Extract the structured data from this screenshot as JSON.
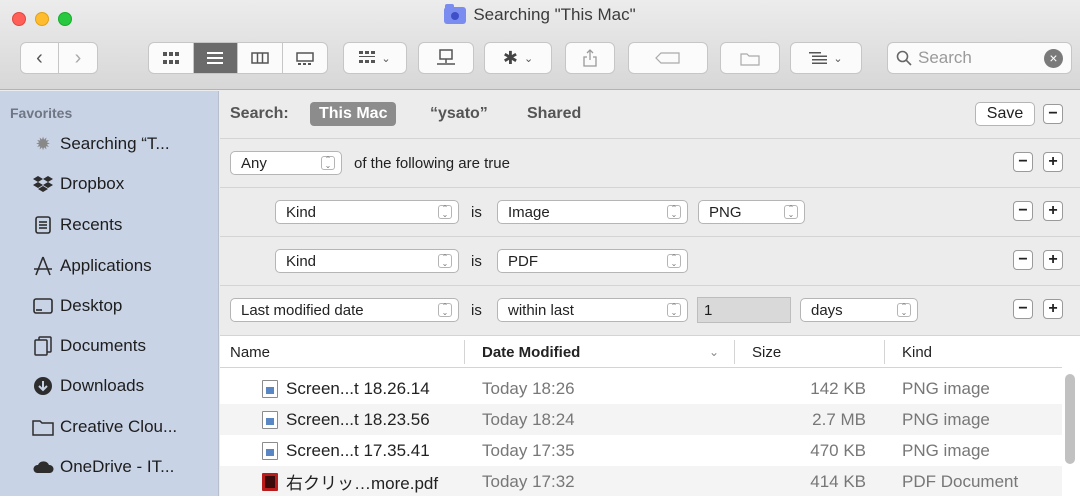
{
  "window": {
    "title": "Searching \"This Mac\""
  },
  "toolbar": {
    "back_icon": "chevron-left-icon",
    "forward_icon": "chevron-right-icon",
    "search_placeholder": "Search"
  },
  "sidebar": {
    "header": "Favorites",
    "items": [
      {
        "label": "Searching “T...",
        "icon": "gear-icon"
      },
      {
        "label": "Dropbox",
        "icon": "dropbox-icon"
      },
      {
        "label": "Recents",
        "icon": "recents-icon"
      },
      {
        "label": "Applications",
        "icon": "applications-icon"
      },
      {
        "label": "Desktop",
        "icon": "desktop-icon"
      },
      {
        "label": "Documents",
        "icon": "documents-icon"
      },
      {
        "label": "Downloads",
        "icon": "downloads-icon"
      },
      {
        "label": "Creative Clou...",
        "icon": "folder-icon"
      },
      {
        "label": "OneDrive - IT...",
        "icon": "cloud-icon"
      }
    ]
  },
  "search": {
    "label": "Search:",
    "scopes": [
      "This Mac",
      "“ysato”",
      "Shared"
    ],
    "save_label": "Save"
  },
  "criteria": {
    "any_value": "Any",
    "following_text": "of the following are true",
    "is_text": "is",
    "rule1": {
      "attribute": "Kind",
      "value": "Image",
      "subvalue": "PNG"
    },
    "rule2": {
      "attribute": "Kind",
      "value": "PDF"
    },
    "rule3": {
      "attribute": "Last modified date",
      "operator": "within last",
      "number": "1",
      "unit": "days"
    }
  },
  "table": {
    "columns": [
      "Name",
      "Date Modified",
      "Size",
      "Kind"
    ],
    "rows": [
      {
        "name": "Screen...t 18.26.14",
        "date": "Today 18:26",
        "size": "142 KB",
        "kind": "PNG image",
        "icon": "png-file-icon"
      },
      {
        "name": "Screen...t 18.23.56",
        "date": "Today 18:24",
        "size": "2.7 MB",
        "kind": "PNG image",
        "icon": "png-file-icon"
      },
      {
        "name": "Screen...t 17.35.41",
        "date": "Today 17:35",
        "size": "470 KB",
        "kind": "PNG image",
        "icon": "png-file-icon"
      },
      {
        "name": "右クリッ…more.pdf",
        "date": "Today 17:32",
        "size": "414 KB",
        "kind": "PDF Document",
        "icon": "pdf-file-icon"
      }
    ]
  }
}
